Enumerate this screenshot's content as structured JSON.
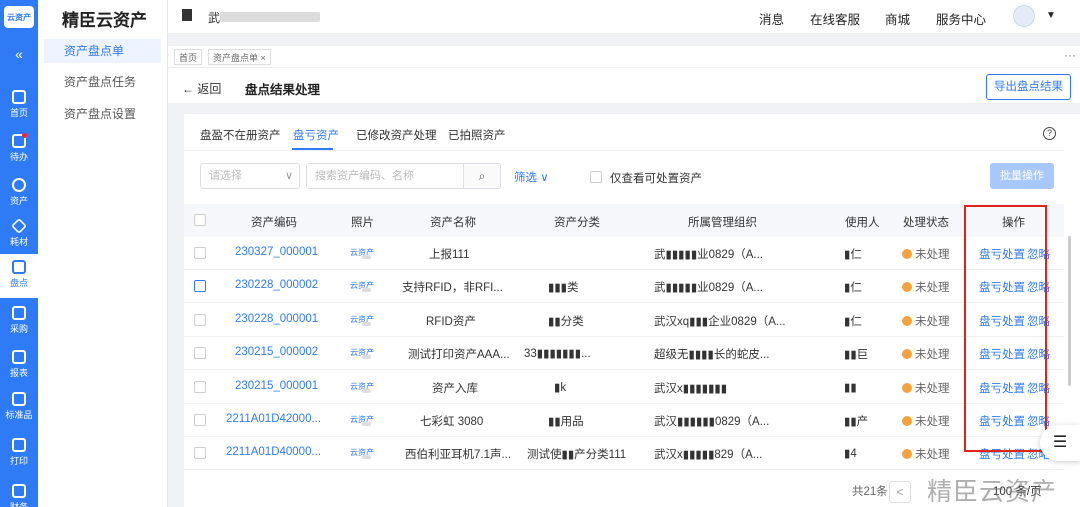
{
  "app": {
    "logo_text": "云资产",
    "brand": "精臣云资产",
    "collapse_glyph": "«",
    "nav": [
      {
        "label": "首页",
        "icon": "home-icon"
      },
      {
        "label": "待办",
        "icon": "todo-icon"
      },
      {
        "label": "资产",
        "icon": "asset-icon"
      },
      {
        "label": "耗材",
        "icon": "consumable-icon"
      },
      {
        "label": "盘点",
        "icon": "inventory-icon"
      },
      {
        "label": "采购",
        "icon": "purchase-icon"
      },
      {
        "label": "报表",
        "icon": "report-icon"
      },
      {
        "label": "标准品",
        "icon": "standard-icon"
      },
      {
        "label": "打印",
        "icon": "print-icon"
      },
      {
        "label": "财务",
        "icon": "finance-icon"
      }
    ],
    "submenu": [
      "资产盘点单",
      "资产盘点任务",
      "资产盘点设置"
    ]
  },
  "topbar": {
    "company_initial": "武",
    "links": [
      "消息",
      "在线客服",
      "商城",
      "服务中心"
    ],
    "caret": "▼"
  },
  "tabs": {
    "items": [
      "首页",
      "资产盘点单 ×"
    ],
    "more": "···"
  },
  "header": {
    "back": "← 返回",
    "title": "盘点结果处理",
    "export_label": "导出盘点结果"
  },
  "filter_tabs": {
    "items": [
      "盘盈不在册资产",
      "盘亏资产",
      "已修改资产处理",
      "已拍照资产"
    ],
    "active": 1,
    "help": "?"
  },
  "toolbar": {
    "select_placeholder": "请选择",
    "select_chevron": "∨",
    "search_placeholder": "搜索资产编码、名称",
    "search_icon": "⌕",
    "filter_label": "筛选 ∨",
    "only_label": "仅查看可处置资产",
    "batch_label": "批量操作"
  },
  "table": {
    "columns": [
      "资产编码",
      "照片",
      "资产名称",
      "资产分类",
      "所属管理组织",
      "使用人",
      "处理状态",
      "操作"
    ],
    "photo_label": "云资产",
    "status_label": "未处理",
    "actions": [
      "盘亏处置",
      "忽略"
    ],
    "rows": [
      {
        "code": "230327_000001",
        "name": "上报111",
        "category": "",
        "org": "武▮▮▮▮▮业0829（A...",
        "user": "▮仁"
      },
      {
        "code": "230228_000002",
        "name": "支持RFID，非RFI...",
        "category": "▮▮▮类",
        "org": "武▮▮▮▮▮业0829（A...",
        "user": "▮仁"
      },
      {
        "code": "230228_000001",
        "name": "RFID资产",
        "category": "▮▮分类",
        "org": "武汉xq▮▮▮企业0829（A...",
        "user": "▮仁"
      },
      {
        "code": "230215_000002",
        "name": "测试打印资产AAA...",
        "category": "33▮▮▮▮▮▮▮...",
        "org": "超级无▮▮▮▮长的蛇皮...",
        "user": "▮▮巨"
      },
      {
        "code": "230215_000001",
        "name": "资产入库",
        "category": "▮k",
        "org": "武汉x▮▮▮▮▮▮▮",
        "user": "▮▮"
      },
      {
        "code": "2211A01D42000...",
        "name": "七彩虹 3080",
        "category": "▮▮用品",
        "org": "武汉▮▮▮▮▮▮0829（A...",
        "user": "▮▮产"
      },
      {
        "code": "2211A01D40000...",
        "name": "西伯利亚耳机7.1声...",
        "category": "测试使▮▮产分类111",
        "org": "武汉x▮▮▮▮▮829（A...",
        "user": "▮4"
      }
    ]
  },
  "pagination": {
    "total": "共21条",
    "prev": "<",
    "page_size": "100 条/页"
  },
  "watermark": "精臣云资产",
  "fab_icon": "☰"
}
